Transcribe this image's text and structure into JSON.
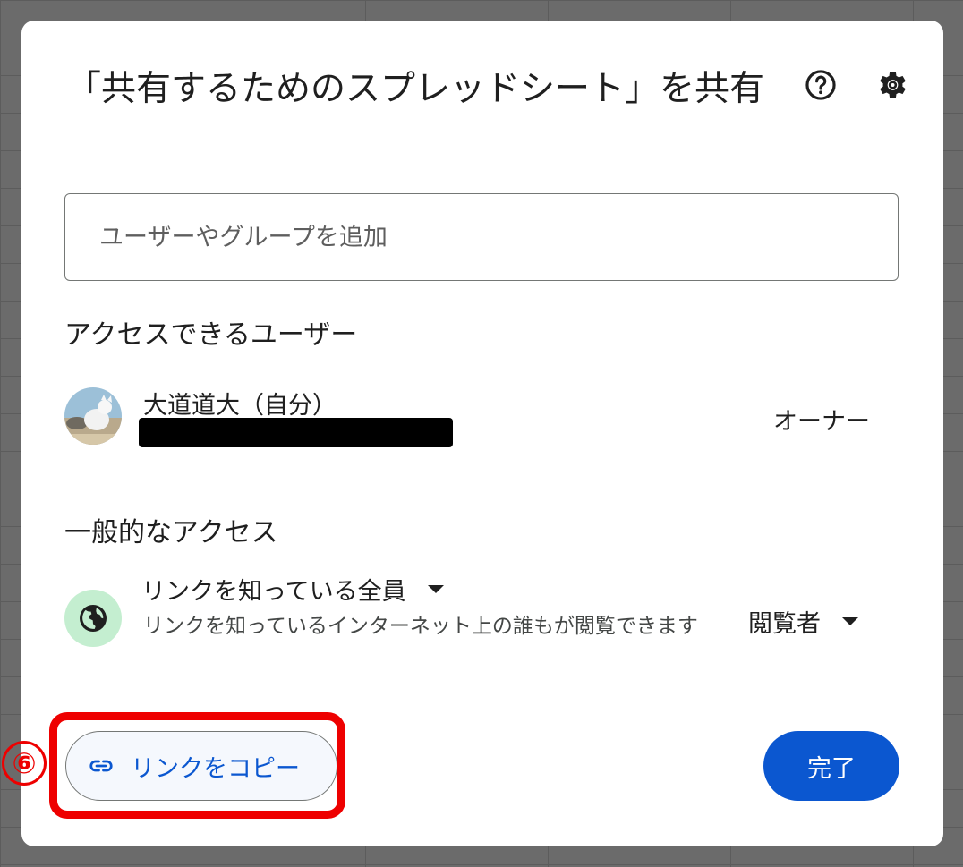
{
  "dialog": {
    "title": "「共有するためのスプレッドシート」を共有",
    "help_icon": "help-circle-icon",
    "settings_icon": "gear-icon"
  },
  "add_people": {
    "placeholder": "ユーザーやグループを追加"
  },
  "people_with_access": {
    "heading": "アクセスできるユーザー",
    "users": [
      {
        "name": "大道道大（自分）",
        "email_redacted": true,
        "role": "オーナー"
      }
    ]
  },
  "general_access": {
    "heading": "一般的なアクセス",
    "scope": "リンクを知っている全員",
    "description": "リンクを知っているインターネット上の誰もが閲覧できます",
    "role": "閲覧者",
    "icon": "globe-icon"
  },
  "footer": {
    "copy_link_label": "リンクをコピー",
    "done_label": "完了"
  },
  "annotation": {
    "step": "⑥",
    "color": "#ee0000"
  },
  "colors": {
    "accent": "#0b57d0",
    "globe_bg": "#c4eed0"
  }
}
